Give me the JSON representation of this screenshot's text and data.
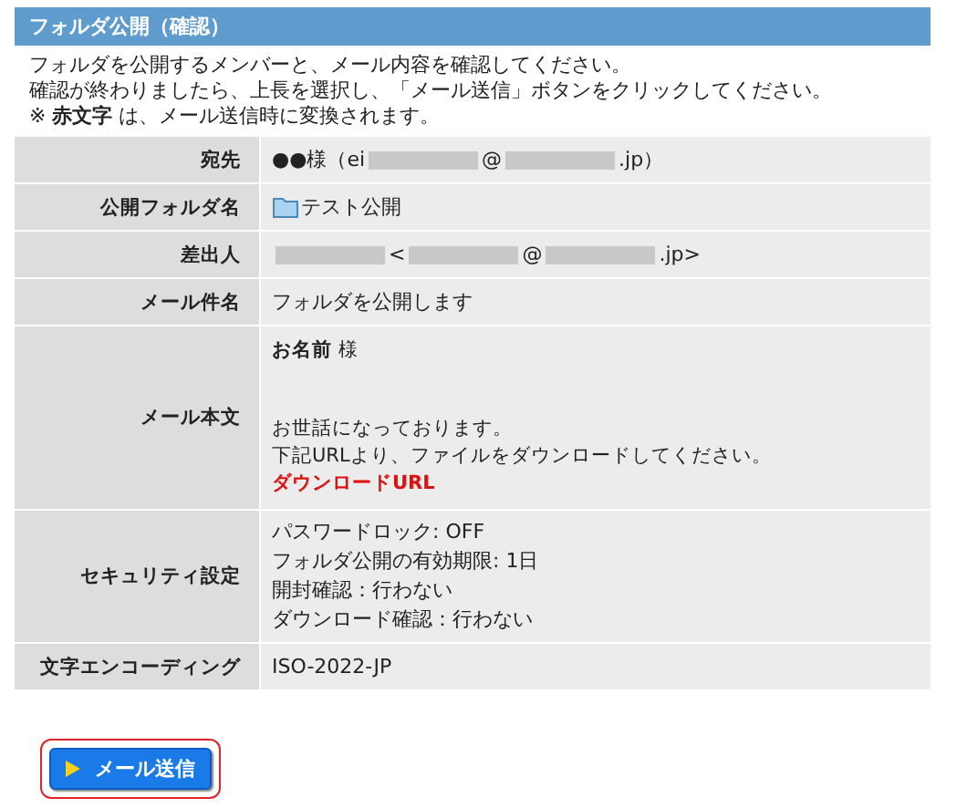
{
  "panel": {
    "title": "フォルダ公開（確認）"
  },
  "instructions": [
    "フォルダを公開するメンバーと、メール内容を確認してください。",
    "確認が終わりましたら、上長を選択し、「メール送信」ボタンをクリックしてください。",
    "※ **赤文字** は、メール送信時に変換されます。"
  ],
  "rows": [
    {
      "label": "宛先",
      "kind": "plain",
      "segments": [
        {
          "kind": "text",
          "text": "●●様（ei"
        },
        {
          "kind": "redacted"
        },
        {
          "kind": "text",
          "text": "@"
        },
        {
          "kind": "redacted"
        },
        {
          "kind": "text",
          "text": ".jp）"
        }
      ]
    },
    {
      "label": "公開フォルダ名",
      "kind": "folder",
      "segments": [
        {
          "kind": "text",
          "text": "テスト公開"
        }
      ]
    },
    {
      "label": "差出人",
      "kind": "plain",
      "segments": [
        {
          "kind": "redacted"
        },
        {
          "kind": "text",
          "text": "<"
        },
        {
          "kind": "redacted"
        },
        {
          "kind": "text",
          "text": "@"
        },
        {
          "kind": "redacted"
        },
        {
          "kind": "text",
          "text": ".jp>"
        }
      ]
    },
    {
      "label": "メール件名",
      "kind": "plain",
      "segments": [
        {
          "kind": "text",
          "text": "フォルダを公開します"
        }
      ]
    },
    {
      "label": "メール本文",
      "kind": "body",
      "paragraphs": [
        [
          {
            "text": "**お名前** 様",
            "red": false
          }
        ],
        [
          {
            "text": "お世話になっております。",
            "red": false
          },
          {
            "text": "下記URLより、ファイルをダウンロードしてください。",
            "red": false
          },
          {
            "text": "ダウンロードURL",
            "red": true
          }
        ]
      ]
    },
    {
      "label": "セキュリティ設定",
      "kind": "list",
      "lines": [
        "パスワードロック: OFF",
        "フォルダ公開の有効期限: 1日",
        "開封確認：行わない",
        "ダウンロード確認：行わない"
      ]
    },
    {
      "label": "文字エンコーディング",
      "kind": "plain",
      "segments": [
        {
          "kind": "text",
          "text": "ISO-2022-JP"
        }
      ]
    }
  ],
  "send_button": {
    "label": "メール送信",
    "focused": true
  }
}
